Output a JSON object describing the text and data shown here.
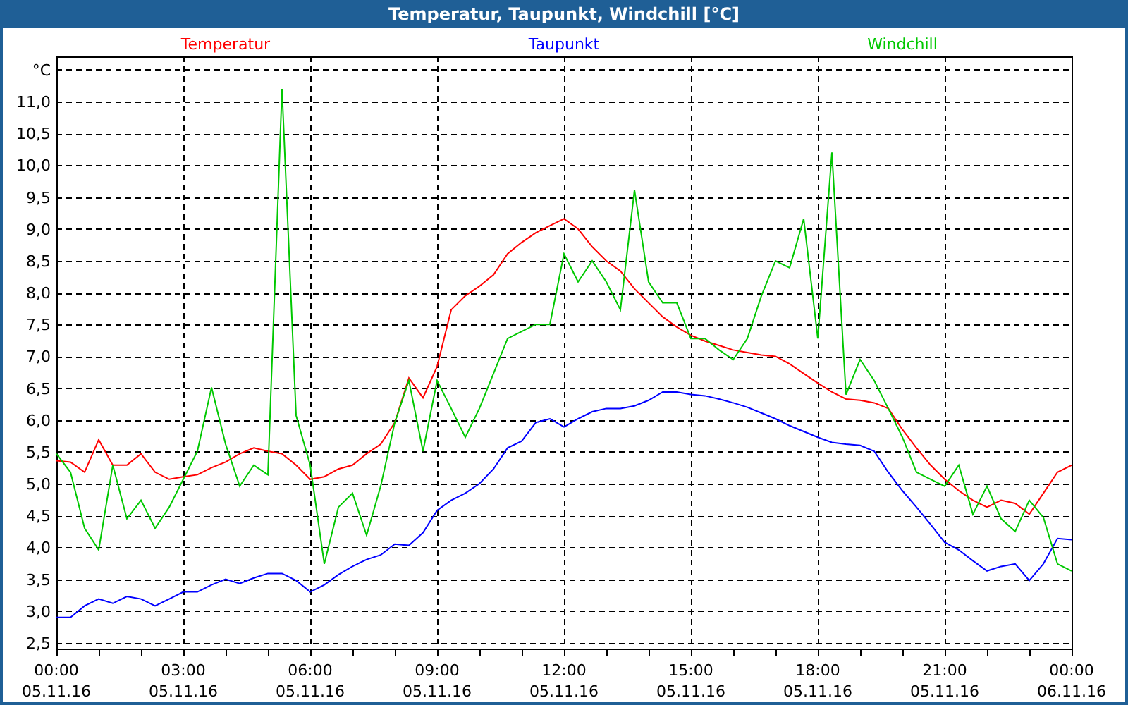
{
  "window": {
    "title": "Temperatur, Taupunkt, Windchill [°C]"
  },
  "chart": {
    "chart_data": {
      "type": "line",
      "ylabel": "°C",
      "categories": [
        "00:00\n05.11.16",
        null,
        null,
        null,
        null,
        null,
        null,
        null,
        null,
        "03:00\n05.11.16",
        null,
        null,
        null,
        null,
        null,
        null,
        null,
        null,
        "06:00\n05.11.16",
        null,
        null,
        null,
        null,
        null,
        null,
        null,
        null,
        "09:00\n05.11.16",
        null,
        null,
        null,
        null,
        null,
        null,
        null,
        null,
        "12:00\n05.11.16",
        null,
        null,
        null,
        null,
        null,
        null,
        null,
        null,
        "15:00\n05.11.16",
        null,
        null,
        null,
        null,
        null,
        null,
        null,
        null,
        "18:00\n05.11.16",
        null,
        null,
        null,
        null,
        null,
        null,
        null,
        null,
        "21:00\n05.11.16",
        null,
        null,
        null,
        null,
        null,
        null,
        null,
        null,
        "00:00\n06.11.16"
      ],
      "series": [
        {
          "name": "Temperatur",
          "color": "#ff0000",
          "values": [
            5.36,
            5.34,
            5.18,
            5.69,
            5.29,
            5.29,
            5.47,
            5.18,
            5.07,
            5.11,
            5.14,
            5.25,
            5.34,
            5.47,
            5.56,
            5.51,
            5.47,
            5.29,
            5.07,
            5.11,
            5.23,
            5.29,
            5.47,
            5.62,
            5.96,
            6.66,
            6.35,
            6.84,
            7.73,
            7.95,
            8.1,
            8.28,
            8.61,
            8.79,
            8.94,
            9.05,
            9.16,
            9.0,
            8.72,
            8.5,
            8.34,
            8.06,
            7.84,
            7.62,
            7.46,
            7.33,
            7.24,
            7.17,
            7.1,
            7.06,
            7.02,
            7.0,
            6.88,
            6.73,
            6.58,
            6.44,
            6.33,
            6.31,
            6.27,
            6.18,
            5.85,
            5.56,
            5.29,
            5.07,
            4.89,
            4.74,
            4.63,
            4.74,
            4.69,
            4.52,
            4.85,
            5.18,
            5.29
          ]
        },
        {
          "name": "Taupunkt",
          "color": "#0000ff",
          "values": [
            2.9,
            2.9,
            3.08,
            3.19,
            3.12,
            3.23,
            3.19,
            3.08,
            3.19,
            3.3,
            3.3,
            3.41,
            3.5,
            3.43,
            3.52,
            3.59,
            3.59,
            3.48,
            3.3,
            3.41,
            3.57,
            3.7,
            3.81,
            3.88,
            4.05,
            4.03,
            4.23,
            4.58,
            4.74,
            4.85,
            5.0,
            5.23,
            5.56,
            5.67,
            5.96,
            6.02,
            5.89,
            6.02,
            6.13,
            6.18,
            6.18,
            6.22,
            6.31,
            6.44,
            6.44,
            6.4,
            6.38,
            6.33,
            6.27,
            6.2,
            6.11,
            6.02,
            5.91,
            5.82,
            5.73,
            5.65,
            5.62,
            5.6,
            5.51,
            5.18,
            4.89,
            4.63,
            4.36,
            4.08,
            3.96,
            3.79,
            3.63,
            3.7,
            3.74,
            3.48,
            3.74,
            4.14,
            4.12
          ]
        },
        {
          "name": "Windchill",
          "color": "#00c800",
          "values": [
            5.47,
            5.18,
            4.3,
            3.96,
            5.29,
            4.45,
            4.74,
            4.3,
            4.63,
            5.07,
            5.51,
            6.51,
            5.62,
            4.96,
            5.29,
            5.14,
            11.2,
            6.07,
            5.29,
            3.74,
            4.63,
            4.85,
            4.19,
            4.96,
            5.96,
            6.62,
            5.51,
            6.62,
            6.18,
            5.73,
            6.18,
            6.73,
            7.28,
            7.39,
            7.5,
            7.5,
            8.61,
            8.17,
            8.5,
            8.17,
            7.73,
            9.61,
            8.17,
            7.84,
            7.84,
            7.28,
            7.28,
            7.1,
            6.95,
            7.28,
            7.95,
            8.5,
            8.39,
            9.16,
            7.28,
            10.2,
            6.4,
            6.95,
            6.62,
            6.18,
            5.73,
            5.18,
            5.07,
            4.96,
            5.29,
            4.52,
            4.96,
            4.45,
            4.25,
            4.74,
            4.47,
            3.74,
            3.63
          ]
        }
      ],
      "ylim": [
        2.41,
        11.71
      ],
      "grid": true,
      "yticks": [
        {
          "value": 2.5,
          "label": "2,5"
        },
        {
          "value": 3,
          "label": "3,0"
        },
        {
          "value": 3.5,
          "label": "3,5"
        },
        {
          "value": 4,
          "label": "4,0"
        },
        {
          "value": 4.5,
          "label": "4,5"
        },
        {
          "value": 5,
          "label": "5,0"
        },
        {
          "value": 5.5,
          "label": "5,5"
        },
        {
          "value": 6,
          "label": "6,0"
        },
        {
          "value": 6.5,
          "label": "6,5"
        },
        {
          "value": 7,
          "label": "7,0"
        },
        {
          "value": 7.5,
          "label": "7,5"
        },
        {
          "value": 8,
          "label": "8,0"
        },
        {
          "value": 8.5,
          "label": "8,5"
        },
        {
          "value": 9,
          "label": "9,0"
        },
        {
          "value": 9.5,
          "label": "9,5"
        },
        {
          "value": 10,
          "label": "10,0"
        },
        {
          "value": 10.5,
          "label": "10,5"
        },
        {
          "value": 11,
          "label": "11,0"
        }
      ]
    }
  }
}
